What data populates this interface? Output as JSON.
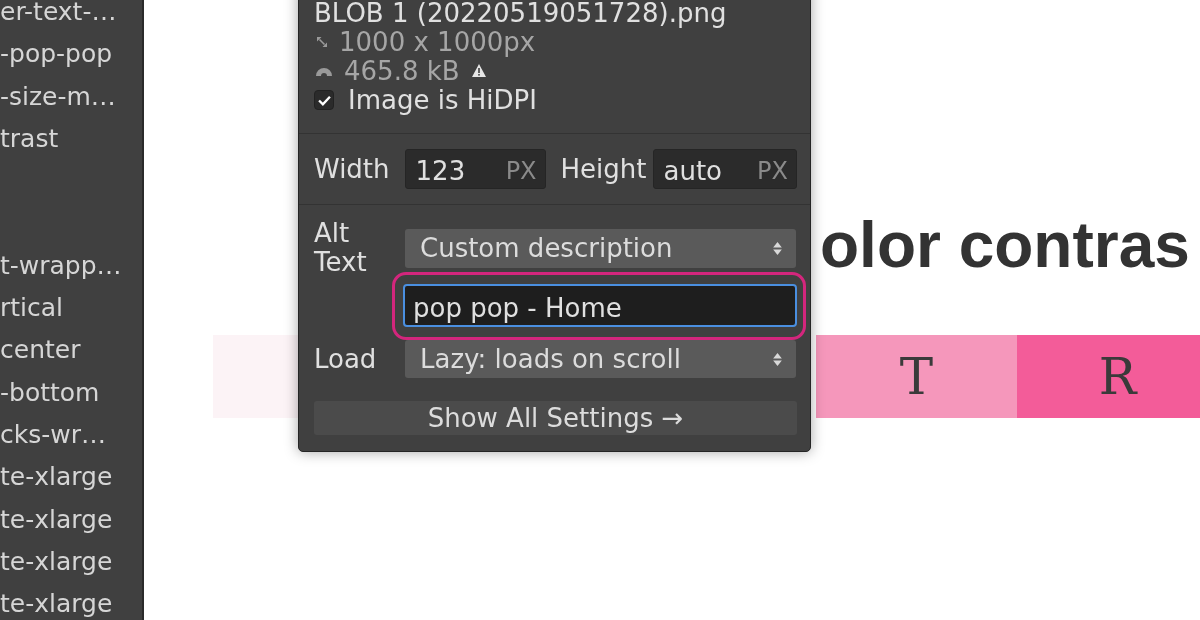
{
  "sidebar": {
    "sections": [
      {
        "items": [
          "er-text-…",
          "-pop-pop",
          "-size-m…",
          "trast"
        ]
      },
      {
        "items": [
          "t-wrapp…",
          "rtical",
          "center",
          "-bottom",
          "cks-wr…",
          "te-xlarge",
          "te-xlarge",
          "te-xlarge",
          "te-xlarge"
        ]
      }
    ]
  },
  "canvas": {
    "heading": "olor contras",
    "swatches": [
      {
        "color": "#fcf3f6"
      },
      {
        "label": "T",
        "color": "#f597bb"
      },
      {
        "label": "R",
        "color": "#f35c99"
      }
    ]
  },
  "image_panel": {
    "file_name": "BLOB 1 (20220519051728).png",
    "dimensions": "1000 x 1000px",
    "file_size": "465.8 kB",
    "size_warning": true,
    "hidpi": {
      "label": "Image is HiDPI",
      "checked": true
    },
    "width": {
      "label": "Width",
      "value": "123",
      "unit": "PX"
    },
    "height": {
      "label": "Height",
      "value": "auto",
      "unit": "PX"
    },
    "alt_text": {
      "label": "Alt Text",
      "option": "Custom description",
      "value": "pop pop - Home",
      "focused": true,
      "highlighted": true
    },
    "load": {
      "label": "Load",
      "option": "Lazy: loads on scroll"
    },
    "button": "Show All Settings →"
  }
}
